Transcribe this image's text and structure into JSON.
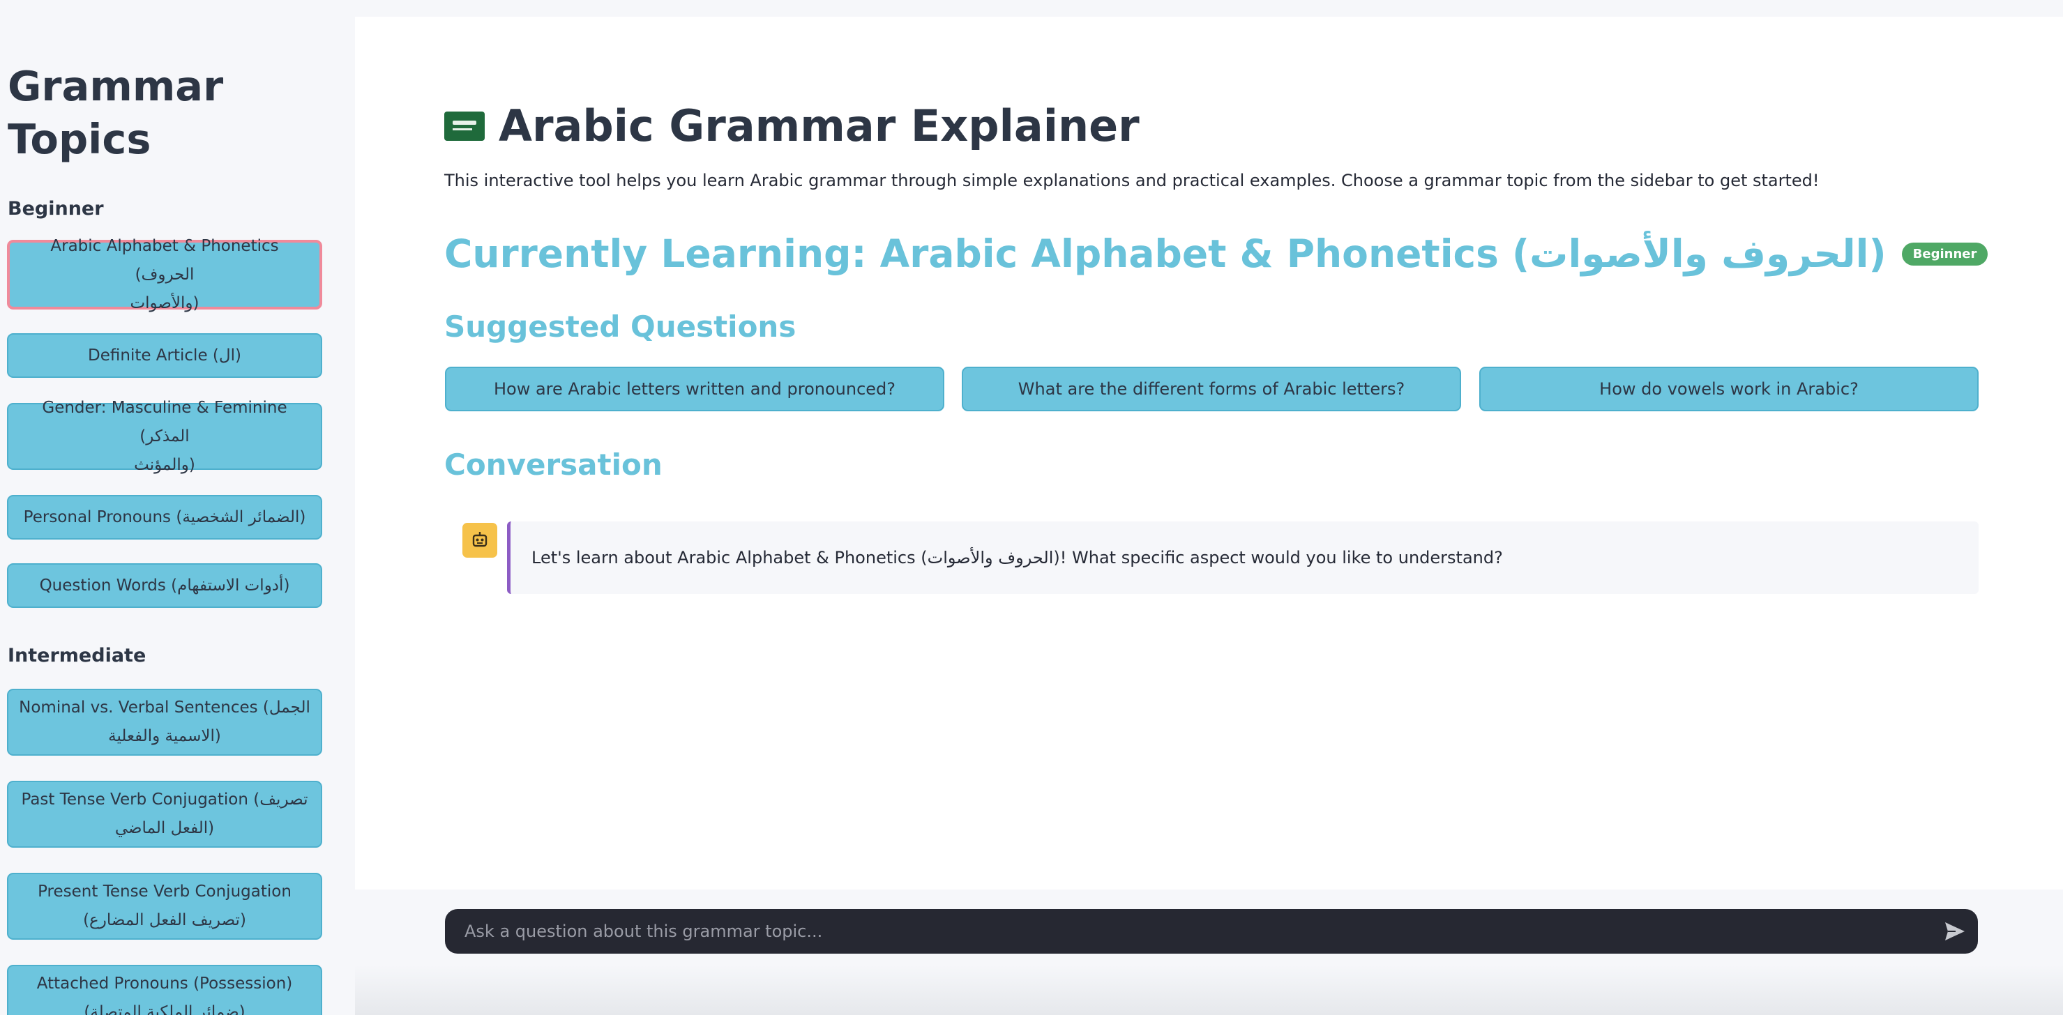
{
  "sidebar": {
    "title": "Grammar Topics",
    "sections": [
      {
        "label": "Beginner"
      },
      {
        "label": "Intermediate"
      }
    ],
    "topics": [
      {
        "line1": "Arabic Alphabet & Phonetics (الحروف",
        "line2": "والأصوات)"
      },
      {
        "line1": "Definite Article (ال)",
        "line2": ""
      },
      {
        "line1": "Gender: Masculine & Feminine (المذكر",
        "line2": "والمؤنث)"
      },
      {
        "line1": "Personal Pronouns (الضمائر الشخصية)",
        "line2": ""
      },
      {
        "line1": "Question Words (أدوات الاستفهام)",
        "line2": ""
      },
      {
        "line1": "Nominal vs. Verbal Sentences (الجمل",
        "line2": "الاسمية والفعلية)"
      },
      {
        "line1": "Past Tense Verb Conjugation (تصريف",
        "line2": "الفعل الماضي)"
      },
      {
        "line1": "Present Tense Verb Conjugation",
        "line2": "(تصريف الفعل المضارع)"
      },
      {
        "line1": "Attached Pronouns (Possession)",
        "line2": "(ضمائر الملكية المتصلة)"
      }
    ]
  },
  "main": {
    "title": "Arabic Grammar Explainer",
    "intro": "This interactive tool helps you learn Arabic grammar through simple explanations and practical examples. Choose a grammar topic from the sidebar to get started!",
    "current_heading": "Currently Learning: Arabic Alphabet & Phonetics (الحروف والأصوات)",
    "level_badge": "Beginner",
    "suggested_heading": "Suggested Questions",
    "suggested_questions": [
      "How are Arabic letters written and pronounced?",
      "What are the different forms of Arabic letters?",
      "How do vowels work in Arabic?"
    ],
    "conversation_heading": "Conversation",
    "messages": [
      {
        "role": "assistant",
        "text": "Let's learn about Arabic Alphabet & Phonetics (الحروف والأصوات)! What specific aspect would you like to understand?"
      }
    ]
  },
  "chat_input": {
    "placeholder": "Ask a question about this grammar topic..."
  },
  "icons": {
    "flag": "saudi-arabia-flag-icon",
    "assistant_avatar": "robot-icon",
    "send": "send-icon"
  },
  "colors": {
    "accent": "#6dc5de",
    "heading_accent": "#69c2da",
    "badge": "#4fa865",
    "active_border": "#f08a9a",
    "message_border": "#8c5cc4",
    "avatar_bg": "#f6c24a",
    "input_bg": "#262832"
  }
}
